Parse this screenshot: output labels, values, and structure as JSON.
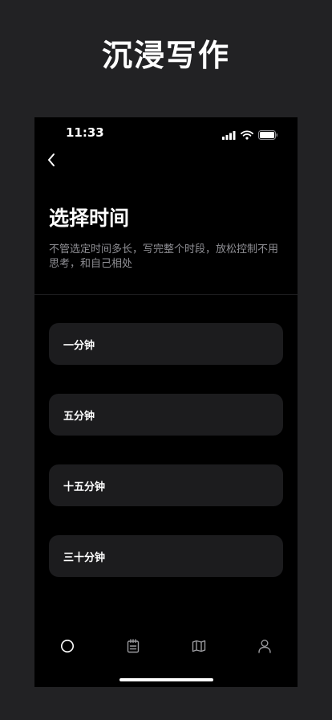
{
  "headline": "沉浸写作",
  "status_bar": {
    "time": "11:33"
  },
  "page": {
    "title": "选择时间",
    "description": "不管选定时间多长，写完整个时段，放松控制不用思考，和自己相处"
  },
  "options": [
    {
      "label": "一分钟"
    },
    {
      "label": "五分钟"
    },
    {
      "label": "十五分钟"
    },
    {
      "label": "三十分钟"
    }
  ],
  "tab_bar": {
    "icons": [
      "circle-icon",
      "notepad-icon",
      "map-icon",
      "person-icon"
    ]
  },
  "colors": {
    "outer_background": "#222224",
    "screen_background": "#000000",
    "card_background": "#1c1c1e",
    "secondary_text": "#8e8e93",
    "tab_icon": "#9a9a9e"
  }
}
